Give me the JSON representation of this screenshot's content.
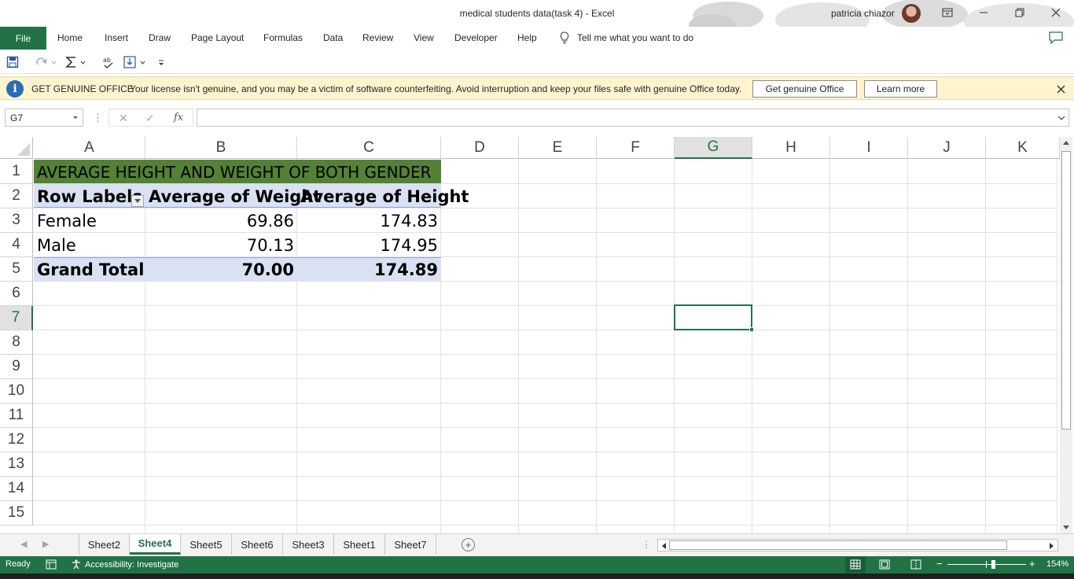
{
  "window": {
    "title": "medical students data(task 4)  -  Excel",
    "user_name": "patricia chiazor"
  },
  "ribbon": {
    "tabs": [
      "File",
      "Home",
      "Insert",
      "Draw",
      "Page Layout",
      "Formulas",
      "Data",
      "Review",
      "View",
      "Developer",
      "Help"
    ],
    "tell_me": "Tell me what you want to do"
  },
  "message_bar": {
    "title": "GET GENUINE OFFICE",
    "text": "Your license isn't genuine, and you may be a victim of software counterfeiting. Avoid interruption and keep your files safe with genuine Office today.",
    "primary_button": "Get genuine Office",
    "secondary_button": "Learn more"
  },
  "formula_bar": {
    "name_box": "G7",
    "fx_label": "fx",
    "formula": ""
  },
  "grid": {
    "columns": [
      "A",
      "B",
      "C",
      "D",
      "E",
      "F",
      "G",
      "H",
      "I",
      "J",
      "K"
    ],
    "selected_column": "G",
    "rows": [
      "1",
      "2",
      "3",
      "4",
      "5",
      "6",
      "7",
      "8",
      "9",
      "10",
      "11",
      "12",
      "13",
      "14",
      "15"
    ],
    "selected_row": "7",
    "selected_cell": "G7"
  },
  "pivot": {
    "title": "AVERAGE HEIGHT AND WEIGHT OF BOTH GENDER",
    "headers": [
      "Row Labels",
      "Average of Weight",
      "Average of Height"
    ],
    "rows": [
      {
        "label": "Female",
        "weight": "69.86",
        "height": "174.83"
      },
      {
        "label": "Male",
        "weight": "70.13",
        "height": "174.95"
      }
    ],
    "total": {
      "label": "Grand Total",
      "weight": "70.00",
      "height": "174.89"
    }
  },
  "sheets": {
    "tabs": [
      "Sheet2",
      "Sheet4",
      "Sheet5",
      "Sheet6",
      "Sheet3",
      "Sheet1",
      "Sheet7"
    ],
    "active": "Sheet4"
  },
  "status": {
    "ready": "Ready",
    "accessibility": "Accessibility: Investigate",
    "zoom": "154%"
  },
  "colors": {
    "excel_green": "#217346",
    "title_band": "#538135",
    "pivot_header": "#d9e1f2",
    "message_bar": "#fff4ce"
  }
}
